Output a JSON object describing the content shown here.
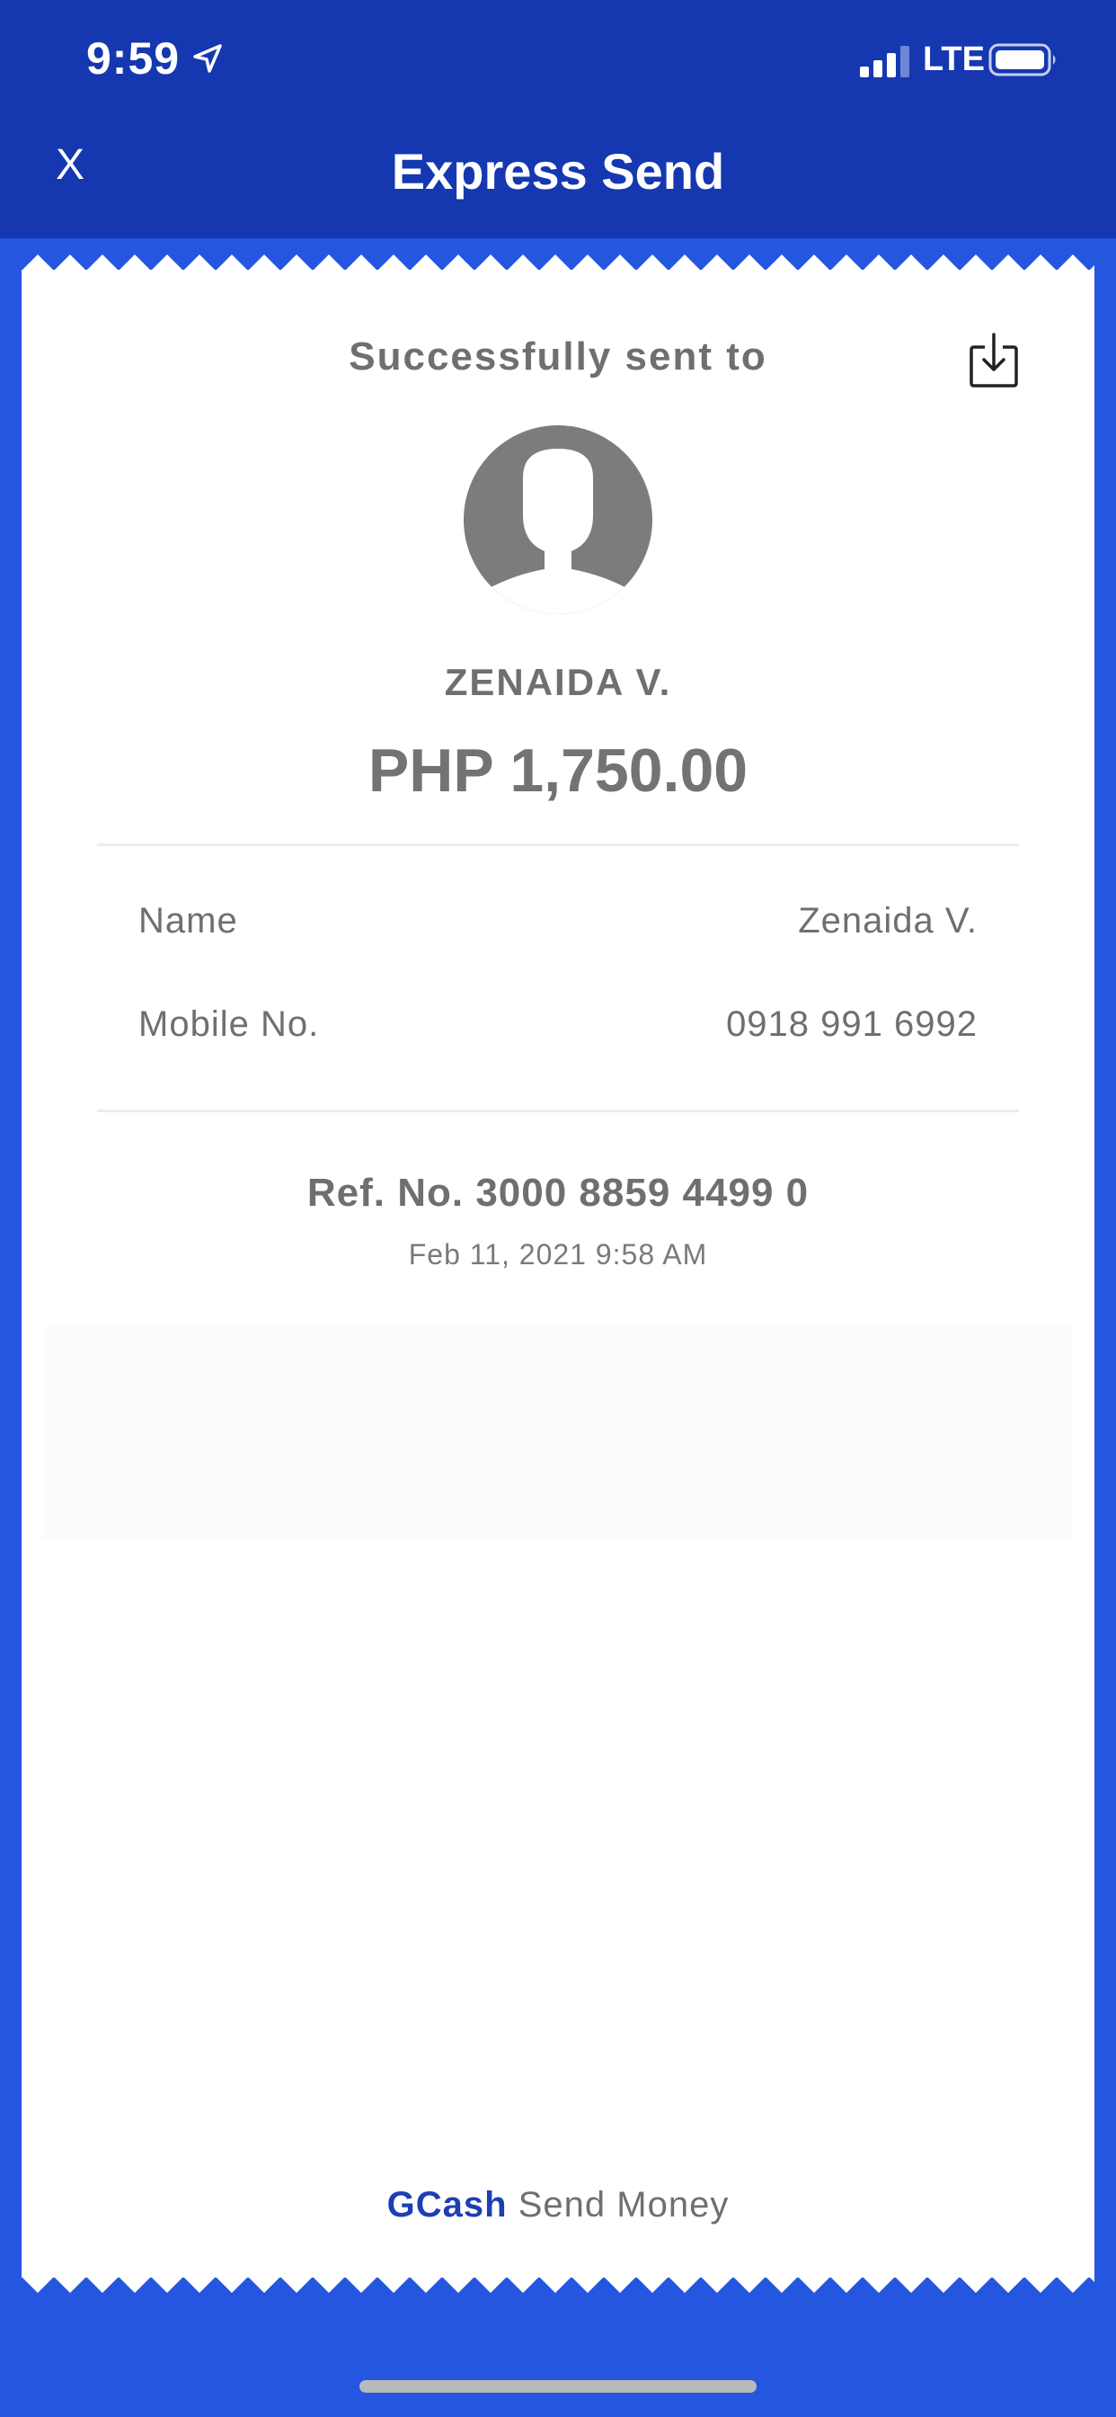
{
  "status_bar": {
    "time": "9:59",
    "network": "LTE"
  },
  "header": {
    "close_label": "X",
    "title": "Express Send"
  },
  "receipt": {
    "success_label": "Successfully sent to",
    "recipient_name": "ZENAIDA V.",
    "amount": "PHP 1,750.00",
    "details": [
      {
        "label": "Name",
        "value": "Zenaida V."
      },
      {
        "label": "Mobile No.",
        "value": "0918 991 6992"
      }
    ],
    "reference": "Ref. No. 3000 8859 4499 0",
    "timestamp": "Feb 11, 2021 9:58 AM"
  },
  "footer": {
    "brand": "GCash",
    "text": "Send Money"
  },
  "icons": {
    "location": "location-arrow-icon",
    "signal": "cellular-signal-icon",
    "battery": "battery-icon",
    "download": "download-icon",
    "avatar": "default-avatar-icon"
  },
  "colors": {
    "header_bg": "#1538b0",
    "page_bg": "#2456e0",
    "brand": "#1d3fb4"
  }
}
